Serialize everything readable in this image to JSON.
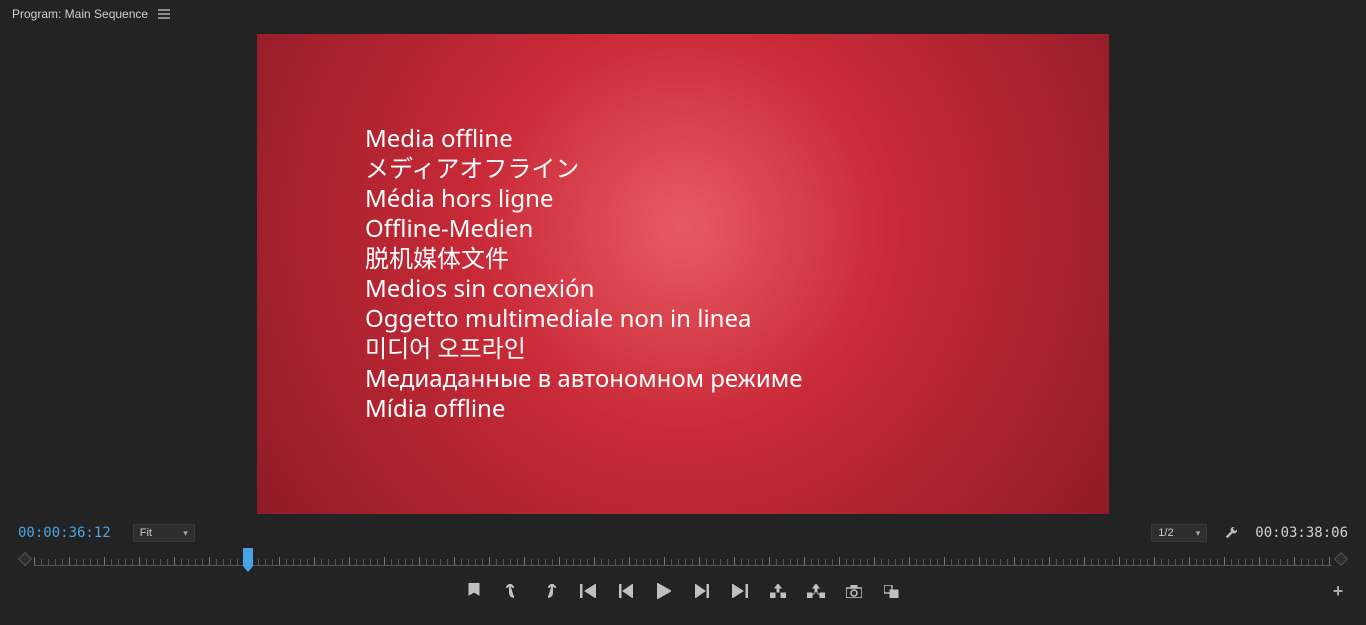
{
  "header": {
    "title": "Program: Main Sequence"
  },
  "viewer": {
    "offline_lines": [
      "Media offline",
      "メディアオフライン",
      "Média hors ligne",
      "Offline-Medien",
      "脱机媒体文件",
      "Medios sin conexión",
      "Oggetto multimediale non in linea",
      "미디어 오프라인",
      "Медиаданные в автономном режиме",
      "Mídia offline"
    ]
  },
  "info": {
    "current_timecode": "00:00:36:12",
    "total_timecode": "00:03:38:06",
    "zoom_label": "Fit",
    "resolution_label": "1/2"
  },
  "playhead_percent": 16.5,
  "icons": {
    "add": "+"
  }
}
